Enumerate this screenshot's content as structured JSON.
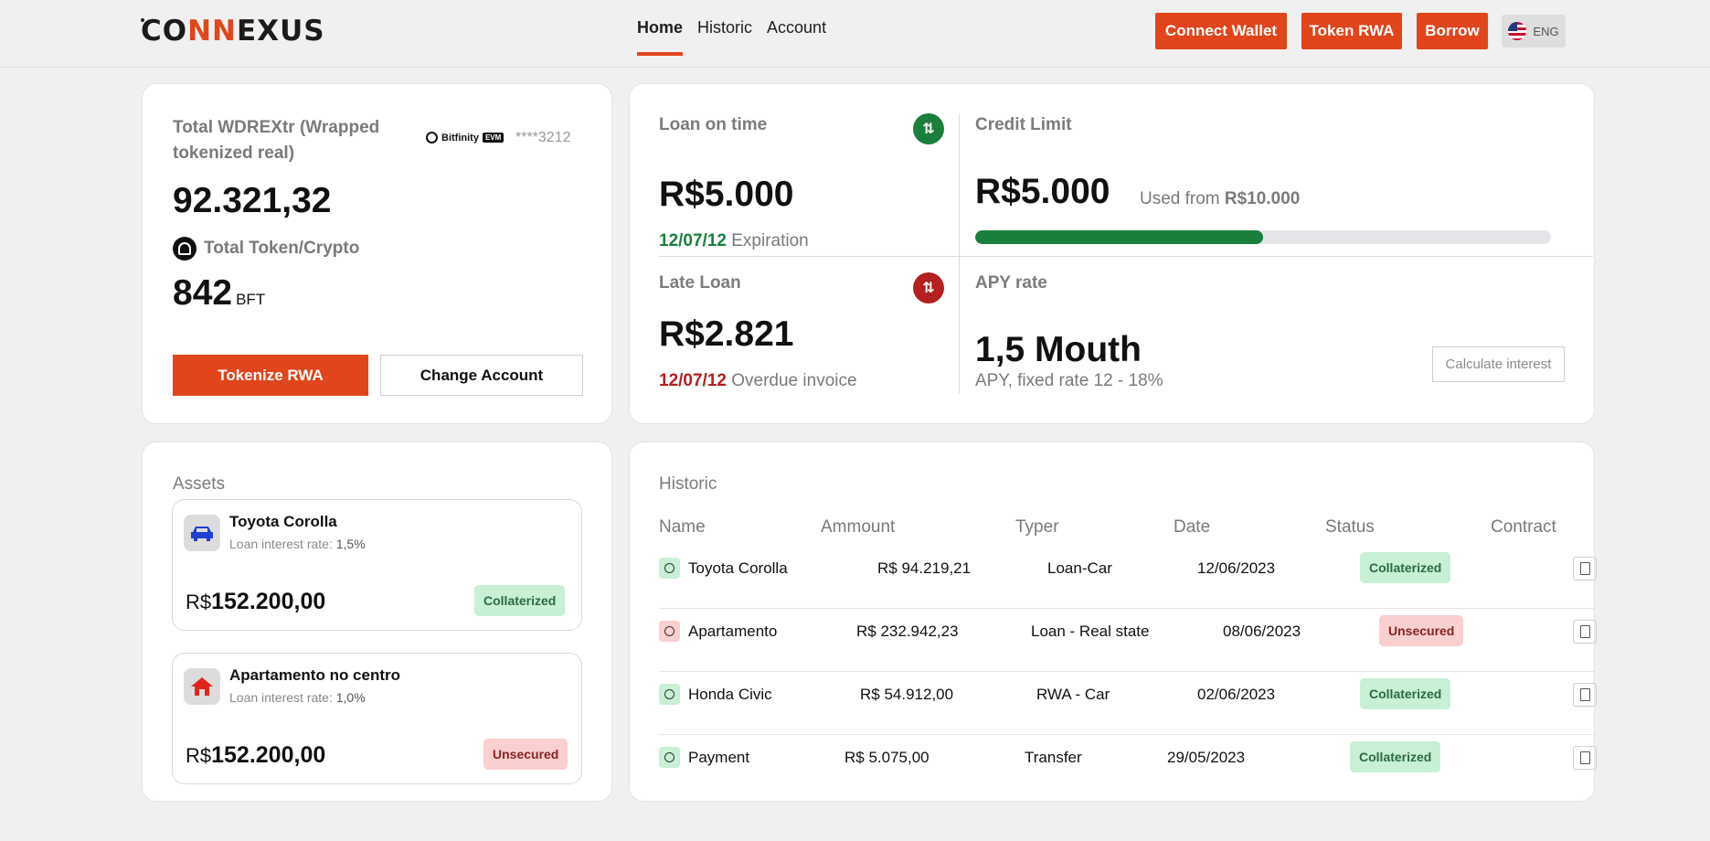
{
  "header": {
    "logo_prefix": "CO",
    "logo_nn": "NN",
    "logo_suffix": "EXUS",
    "nav": [
      "Home",
      "Historic",
      "Account"
    ],
    "buttons": {
      "connect": "Connect Wallet",
      "token": "Token RWA",
      "borrow": "Borrow"
    },
    "lang": "ENG"
  },
  "wallet": {
    "title": "Total WDREXtr (Wrapped tokenized real)",
    "network": "Bitfinity",
    "network_tag": "EVM",
    "account": "****3212",
    "total": "92.321,32",
    "token_label": "Total Token/Crypto",
    "token_amount": "842",
    "token_unit": "BFT",
    "btn_tokenize": "Tokenize RWA",
    "btn_change": "Change Account"
  },
  "loans": {
    "on_time_label": "Loan on time",
    "on_time_value": "R$5.000",
    "on_time_date": "12/07/12",
    "on_time_note": "Expiration",
    "credit_label": "Credit Limit",
    "credit_value": "R$5.000",
    "credit_used_prefix": "Used from",
    "credit_total": "R$10.000",
    "credit_fraction": 0.5,
    "late_label": "Late Loan",
    "late_value": "R$2.821",
    "late_date": "12/07/12",
    "late_note": "Overdue invoice",
    "apy_label": "APY rate",
    "apy_value": "1,5 Mouth",
    "apy_note": "APY, fixed rate 12 - 18%",
    "calc_btn": "Calculate interest",
    "up_arrow": "⇅",
    "down_arrow": "⇅"
  },
  "assets": {
    "title": "Assets",
    "items": [
      {
        "name": "Toyota Corolla",
        "rate_label": "Loan interest rate:",
        "rate": "1,5%",
        "currency": "R$",
        "price": "152.200,00",
        "status": "Collaterized",
        "icon": "car-icon"
      },
      {
        "name": "Apartamento no centro",
        "rate_label": "Loan interest rate:",
        "rate": "1,0%",
        "currency": "R$",
        "price": "152.200,00",
        "status": "Unsecured",
        "icon": "house-icon"
      }
    ]
  },
  "historic": {
    "title": "Historic",
    "columns": [
      "Name",
      "Ammount",
      "Typer",
      "Date",
      "Status",
      "Contract"
    ],
    "rows": [
      {
        "name": "Toyota Corolla",
        "amount": "R$ 94.219,21",
        "type": "Loan-Car",
        "date": "12/06/2023",
        "status": "Collaterized"
      },
      {
        "name": "Apartamento",
        "amount": "R$ 232.942,23",
        "type": "Loan - Real state",
        "date": "08/06/2023",
        "status": "Unsecured"
      },
      {
        "name": "Honda Civic",
        "amount": "R$ 54.912,00",
        "type": "RWA - Car",
        "date": "02/06/2023",
        "status": "Collaterized"
      },
      {
        "name": "Payment",
        "amount": "R$ 5.075,00",
        "type": "Transfer",
        "date": "29/05/2023",
        "status": "Collaterized"
      }
    ]
  },
  "colors": {
    "accent": "#e0451b",
    "success": "#1a7f3c",
    "danger": "#b3201f"
  }
}
